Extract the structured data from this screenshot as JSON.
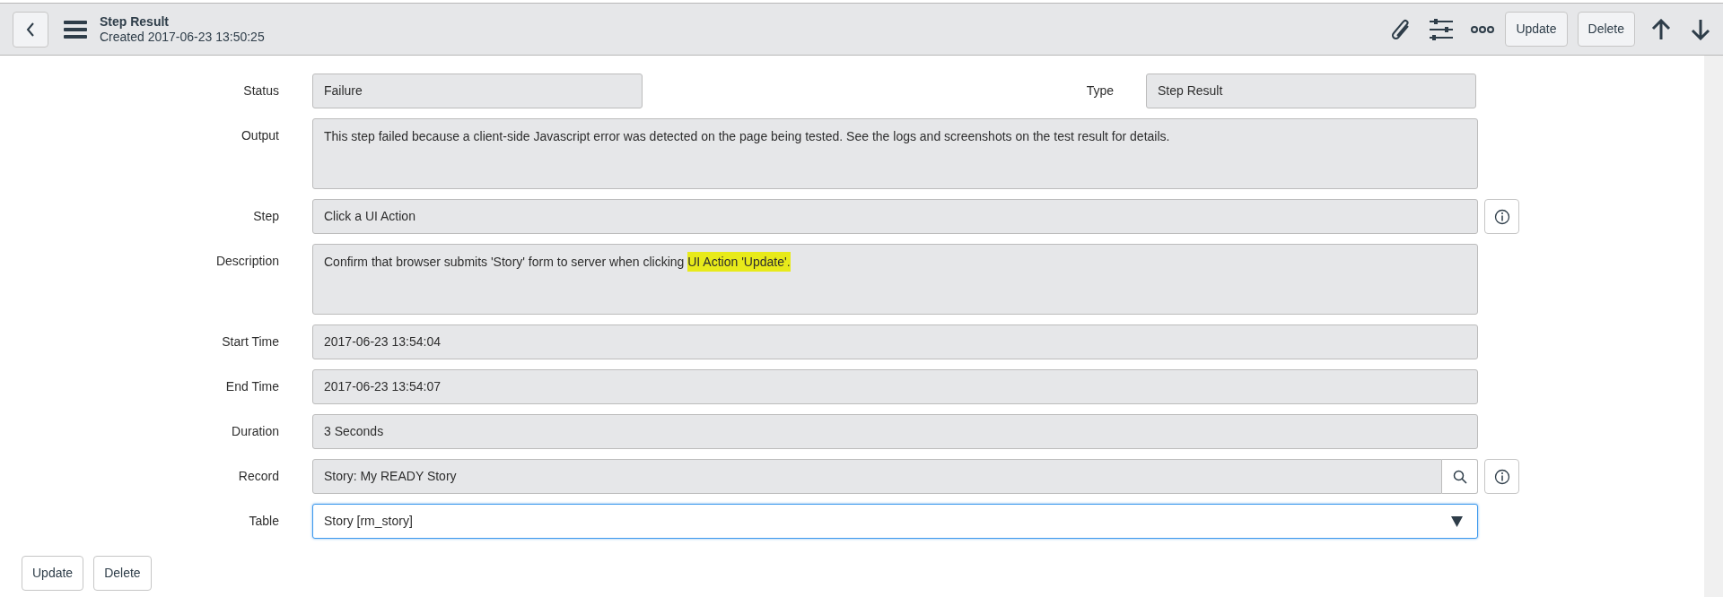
{
  "header": {
    "title": "Step Result",
    "subtitle": "Created 2017-06-23 13:50:25",
    "buttons": [
      "Update",
      "Delete"
    ]
  },
  "rows": [
    {
      "fields": [
        {
          "label": "Status",
          "kind": "text",
          "value": "Failure"
        },
        {
          "label": "Type",
          "kind": "text",
          "value": "Step Result"
        }
      ]
    },
    {
      "fields": [
        {
          "label": "Output",
          "kind": "textarea",
          "value": "This step failed because a client-side Javascript error was detected on the page being tested. See the logs and screenshots on the test result for details."
        }
      ]
    },
    {
      "fields": [
        {
          "label": "Step",
          "kind": "text",
          "value": "Click a UI Action",
          "info_button": true
        }
      ]
    },
    {
      "fields": [
        {
          "label": "Description",
          "kind": "textarea",
          "segments": [
            {
              "text": "Confirm that browser submits 'Story' form to server when clicking ",
              "highlighted": false
            },
            {
              "text": "UI Action 'Update'.",
              "highlighted": true
            }
          ]
        }
      ]
    },
    {
      "fields": [
        {
          "label": "Start Time",
          "kind": "text",
          "value": "2017-06-23 13:54:04"
        }
      ]
    },
    {
      "fields": [
        {
          "label": "End Time",
          "kind": "text",
          "value": "2017-06-23 13:54:07"
        }
      ]
    },
    {
      "fields": [
        {
          "label": "Duration",
          "kind": "text",
          "value": "3 Seconds"
        }
      ]
    },
    {
      "fields": [
        {
          "label": "Record",
          "kind": "reference",
          "value": "Story: My READY Story",
          "info_button": true
        }
      ]
    },
    {
      "fields": [
        {
          "label": "Table",
          "kind": "select",
          "value": "Story [rm_story]"
        }
      ]
    }
  ],
  "footer_buttons": [
    "Update",
    "Delete"
  ]
}
